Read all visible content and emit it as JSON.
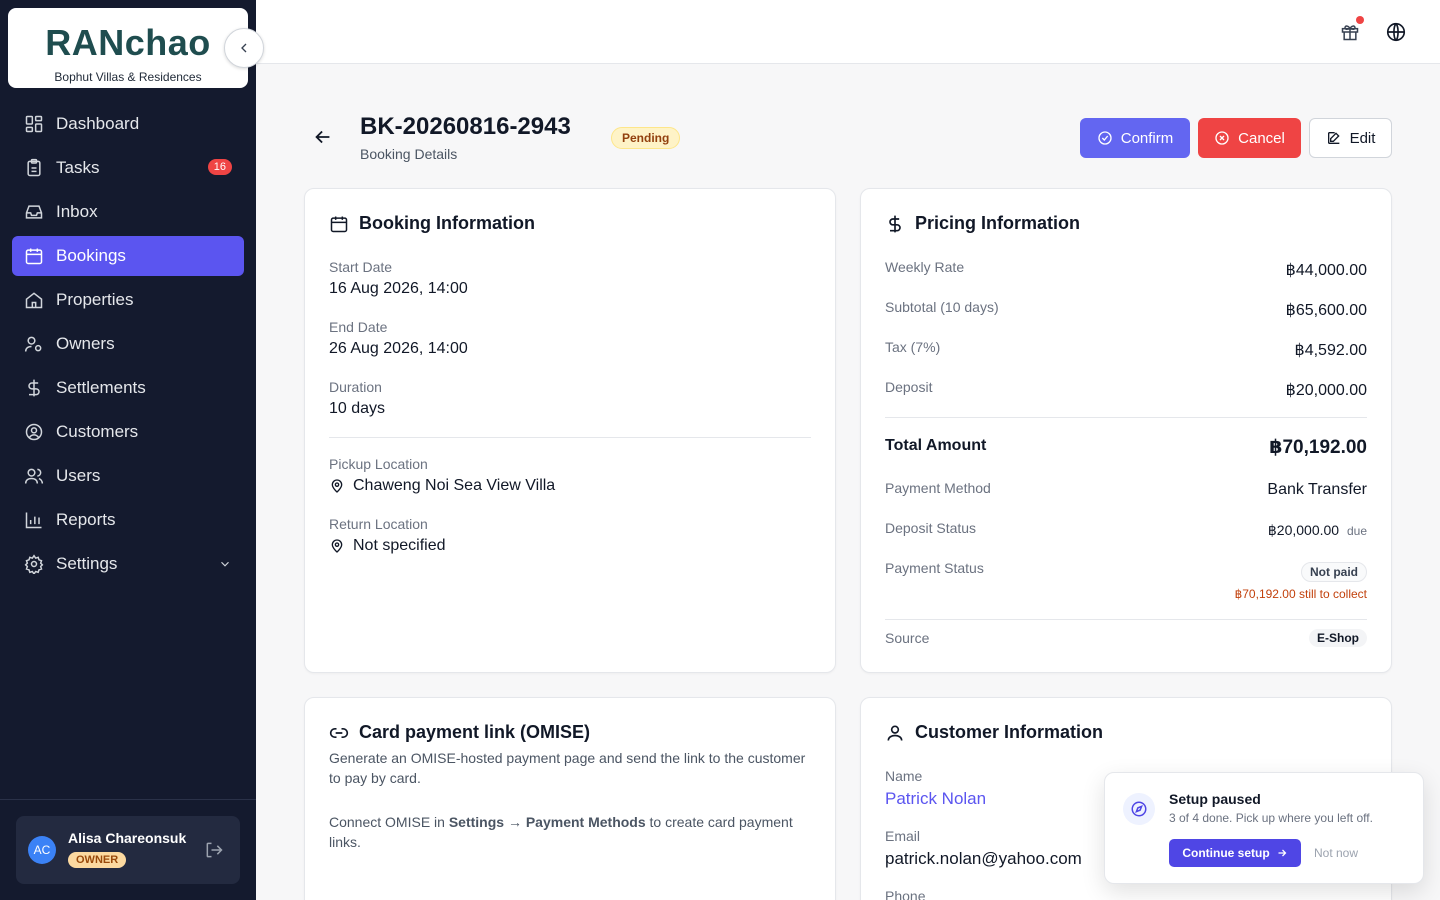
{
  "brand": {
    "name": "RANchao",
    "subtitle": "Bophut Villas & Residences"
  },
  "nav": [
    {
      "label": "Dashboard",
      "icon": "dashboard-icon"
    },
    {
      "label": "Tasks",
      "icon": "clipboard-icon",
      "badge": "16"
    },
    {
      "label": "Inbox",
      "icon": "inbox-icon"
    },
    {
      "label": "Bookings",
      "icon": "calendar-icon",
      "active": true
    },
    {
      "label": "Properties",
      "icon": "home-icon"
    },
    {
      "label": "Owners",
      "icon": "owner-icon"
    },
    {
      "label": "Settlements",
      "icon": "dollar-icon"
    },
    {
      "label": "Customers",
      "icon": "user-circle-icon"
    },
    {
      "label": "Users",
      "icon": "users-icon"
    },
    {
      "label": "Reports",
      "icon": "bar-chart-icon"
    },
    {
      "label": "Settings",
      "icon": "gear-icon"
    }
  ],
  "user": {
    "initials": "AC",
    "name": "Alisa Chareonsuk",
    "role": "OWNER"
  },
  "header": {
    "title": "BK-20260816-2943",
    "subtitle": "Booking Details",
    "status": "Pending",
    "confirm_label": "Confirm",
    "cancel_label": "Cancel",
    "edit_label": "Edit"
  },
  "booking": {
    "title": "Booking Information",
    "start_label": "Start Date",
    "start_value": "16 Aug 2026, 14:00",
    "end_label": "End Date",
    "end_value": "26 Aug 2026, 14:00",
    "duration_label": "Duration",
    "duration_value": "10 days",
    "pickup_label": "Pickup Location",
    "pickup_value": "Chaweng Noi Sea View Villa",
    "return_label": "Return Location",
    "return_value": "Not specified"
  },
  "pricing": {
    "title": "Pricing Information",
    "weekly_label": "Weekly Rate",
    "weekly_value": "฿44,000.00",
    "subtotal_label": "Subtotal (10 days)",
    "subtotal_value": "฿65,600.00",
    "tax_label": "Tax (7%)",
    "tax_value": "฿4,592.00",
    "deposit_label": "Deposit",
    "deposit_value": "฿20,000.00",
    "total_label": "Total Amount",
    "total_value": "฿70,192.00",
    "method_label": "Payment Method",
    "method_value": "Bank Transfer",
    "deposit_status_label": "Deposit Status",
    "deposit_status_value": "฿20,000.00",
    "deposit_status_suffix": "due",
    "payment_status_label": "Payment Status",
    "payment_status_value": "Not paid",
    "payment_status_note": "฿70,192.00 still to collect",
    "source_label": "Source",
    "source_value": "E-Shop"
  },
  "omise": {
    "title": "Card payment link (OMISE)",
    "description": "Generate an OMISE-hosted payment page and send the link to the customer to pay by card.",
    "connect_prefix": "Connect OMISE in ",
    "connect_path": "Settings → Payment Methods",
    "connect_suffix": " to create card payment links."
  },
  "customer": {
    "title": "Customer Information",
    "name_label": "Name",
    "name_value": "Patrick Nolan",
    "email_label": "Email",
    "email_value": "patrick.nolan@yahoo.com",
    "phone_label": "Phone"
  },
  "setup": {
    "title": "Setup paused",
    "text": "3 of 4 done. Pick up where you left off.",
    "continue_label": "Continue setup",
    "later_label": "Not now"
  },
  "colors": {
    "accent": "#5b55f0",
    "danger": "#ef4444",
    "sidebar": "#141a2e"
  }
}
